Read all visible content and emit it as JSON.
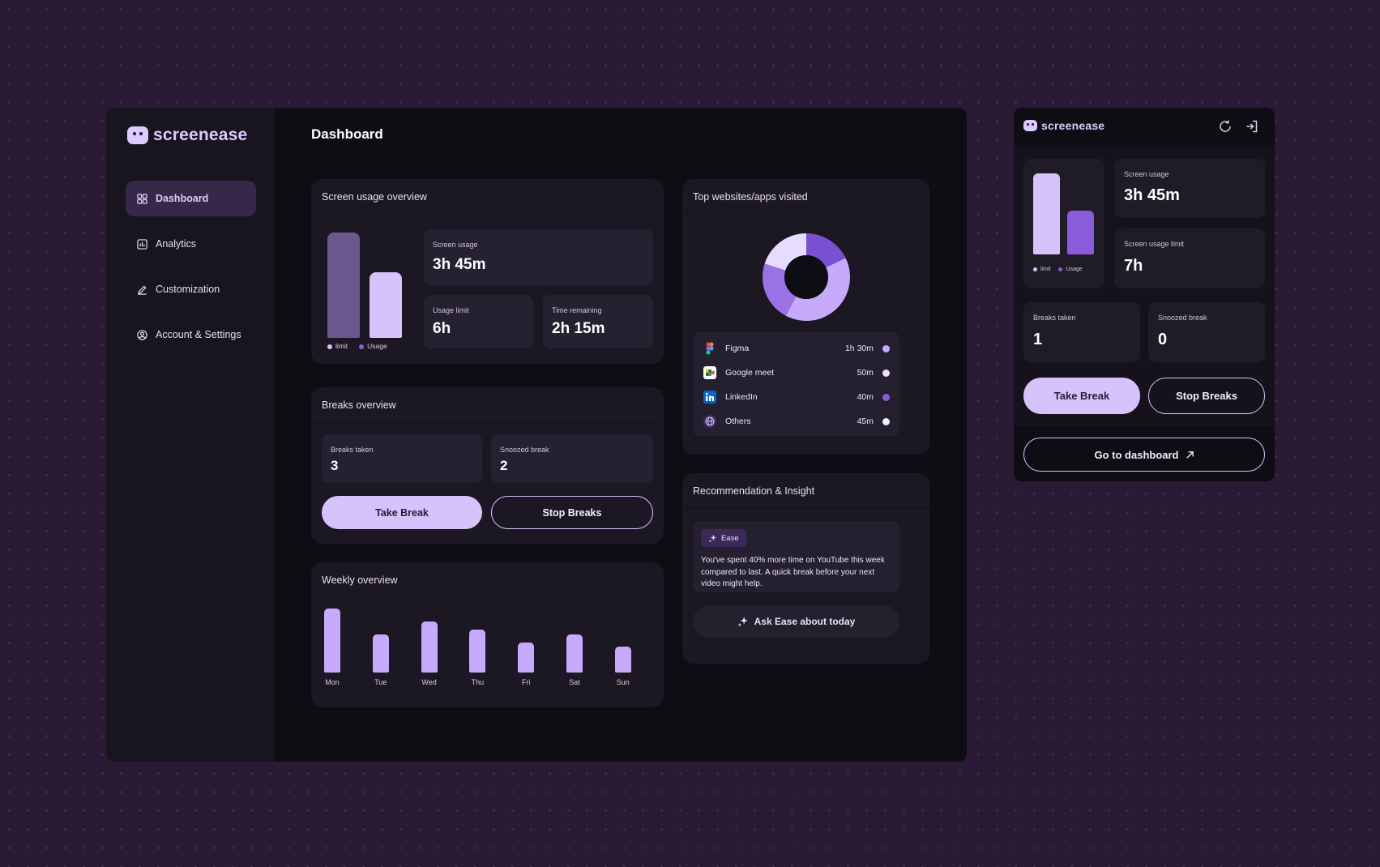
{
  "brand": {
    "name": "screenease"
  },
  "sidebar": {
    "items": [
      {
        "label": "Dashboard",
        "icon": "dashboard-icon",
        "active": true
      },
      {
        "label": "Analytics",
        "icon": "analytics-icon",
        "active": false
      },
      {
        "label": "Customization",
        "icon": "pencil-icon",
        "active": false
      },
      {
        "label": "Account & Settings",
        "icon": "account-icon",
        "active": false
      }
    ]
  },
  "header": {
    "title": "Dashboard"
  },
  "usage_overview": {
    "title": "Screen usage overview",
    "legend": {
      "limit": "limit",
      "usage": "Usage"
    },
    "screen_usage": {
      "label": "Screen usage",
      "value": "3h 45m"
    },
    "usage_limit": {
      "label": "Usage  limit",
      "value": "6h"
    },
    "time_remaining": {
      "label": "Time remaining",
      "value": "2h 15m"
    }
  },
  "breaks_overview": {
    "title": "Breaks overview",
    "breaks_taken": {
      "label": "Breaks taken",
      "value": "3"
    },
    "snoozed": {
      "label": "Snoozed break",
      "value": "2"
    },
    "take_break": "Take Break",
    "stop_breaks": "Stop Breaks"
  },
  "weekly_overview": {
    "title": "Weekly overview"
  },
  "top_apps": {
    "title": "Top websites/apps visited",
    "items": [
      {
        "name": "Figma",
        "time": "1h 30m",
        "icon": "figma-icon",
        "color": "#c7aafb"
      },
      {
        "name": "Google meet",
        "time": "50m",
        "icon": "google-meet-icon",
        "color": "#e8dcff"
      },
      {
        "name": "LinkedIn",
        "time": "40m",
        "icon": "linkedin-icon",
        "color": "#8a5cdb"
      },
      {
        "name": "Others",
        "time": "45m",
        "icon": "globe-icon",
        "color": "#f3efff"
      }
    ]
  },
  "insight": {
    "title": "Recommendation & Insight",
    "tag": "Ease",
    "text": "You've spent 40% more time on YouTube this week compared to last. A quick break before your next video might help.",
    "ask_button": "Ask Ease about today"
  },
  "widget": {
    "legend": {
      "limit": "limit",
      "usage": "Usage"
    },
    "screen_usage": {
      "label": "Screen usage",
      "value": "3h 45m"
    },
    "usage_limit": {
      "label": "Screen usage limit",
      "value": "7h"
    },
    "breaks_taken": {
      "label": "Breaks taken",
      "value": "1"
    },
    "snoozed": {
      "label": "Snoozed break",
      "value": "0"
    },
    "take_break": "Take Break",
    "stop_breaks": "Stop Breaks",
    "go_dashboard": "Go to dashboard"
  },
  "colors": {
    "accent": "#d6c3fb",
    "accent_strong": "#8a5cdb",
    "limit_bar": "#6b5690",
    "usage_bar": "#d6c3fb"
  },
  "chart_data": [
    {
      "type": "bar",
      "categories": [
        "limit",
        "Usage"
      ],
      "values": [
        6,
        3.75
      ],
      "ylim": [
        0,
        6
      ]
    },
    {
      "type": "bar",
      "categories": [
        "Mon",
        "Tue",
        "Wed",
        "Thu",
        "Fri",
        "Sat",
        "Sun"
      ],
      "values": [
        7.5,
        4.5,
        6,
        5,
        3.5,
        4.5,
        3
      ],
      "ylim": [
        0,
        8
      ]
    },
    {
      "type": "pie",
      "categories": [
        "Figma",
        "Google meet",
        "LinkedIn",
        "Others"
      ],
      "values": [
        90,
        50,
        40,
        45
      ]
    },
    {
      "type": "bar",
      "categories": [
        "limit",
        "Usage"
      ],
      "values": [
        7,
        3.75
      ],
      "ylim": [
        0,
        7
      ]
    }
  ]
}
